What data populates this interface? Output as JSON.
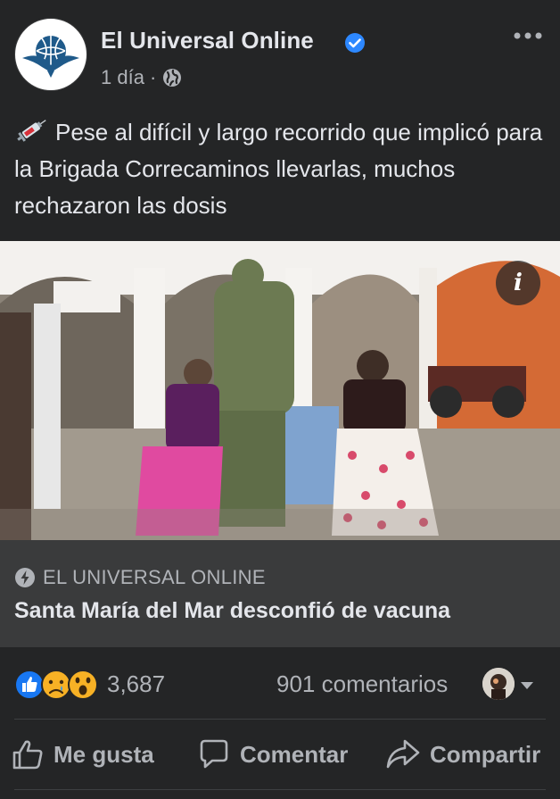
{
  "post": {
    "page_name": "El Universal Online",
    "verified_icon": "verified-badge-icon",
    "time": "1 día",
    "separator": "·",
    "audience_icon": "globe-icon",
    "more_icon": "more-options-icon",
    "text_emoji": "syringe-icon",
    "text": "Pese al difícil y largo recorrido que implicó para la Brigada Correcaminos llevarlas, muchos rechazaron las dosis"
  },
  "photo": {
    "info_label": "i"
  },
  "link": {
    "source_icon": "bolt-icon",
    "source": "EL UNIVERSAL ONLINE",
    "title": "Santa María del Mar desconfió de vacuna"
  },
  "stats": {
    "reaction_icons": [
      "like-icon",
      "sad-icon",
      "wow-icon"
    ],
    "reactions_count": "3,687",
    "comments_count": "901 comentarios"
  },
  "actions": {
    "like": "Me gusta",
    "comment": "Comentar",
    "share": "Compartir"
  },
  "colors": {
    "background": "#242526",
    "card": "#3a3b3c",
    "text_primary": "#e4e6eb",
    "text_secondary": "#b0b3b8",
    "verified": "#2d88ff",
    "like_blue": "#1877f2"
  }
}
